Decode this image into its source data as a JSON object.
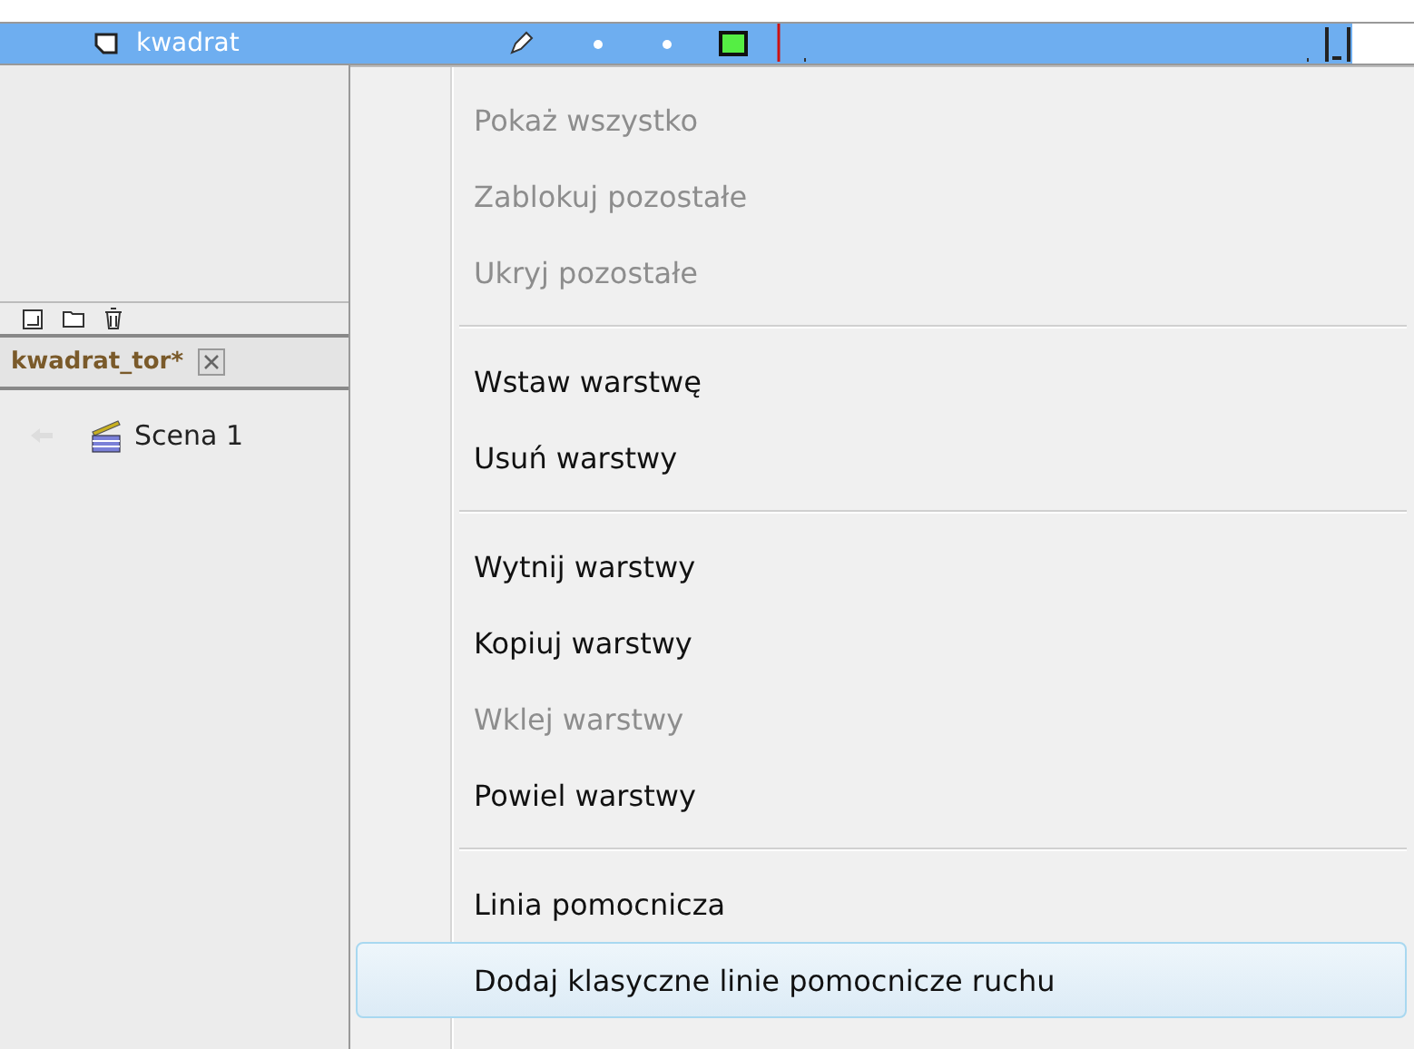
{
  "layer_row": {
    "name": "kwadrat",
    "selected": true
  },
  "document_tab": {
    "label": "kwadrat_tor*"
  },
  "breadcrumb": {
    "scene": "Scena 1"
  },
  "context_menu": {
    "items": [
      {
        "kind": "item",
        "label": "Pokaż wszystko",
        "disabled": true,
        "selected": false
      },
      {
        "kind": "item",
        "label": "Zablokuj pozostałe",
        "disabled": true,
        "selected": false
      },
      {
        "kind": "item",
        "label": "Ukryj pozostałe",
        "disabled": true,
        "selected": false
      },
      {
        "kind": "separator"
      },
      {
        "kind": "item",
        "label": "Wstaw warstwę",
        "disabled": false,
        "selected": false
      },
      {
        "kind": "item",
        "label": "Usuń warstwy",
        "disabled": false,
        "selected": false
      },
      {
        "kind": "separator"
      },
      {
        "kind": "item",
        "label": "Wytnij warstwy",
        "disabled": false,
        "selected": false
      },
      {
        "kind": "item",
        "label": "Kopiuj warstwy",
        "disabled": false,
        "selected": false
      },
      {
        "kind": "item",
        "label": "Wklej warstwy",
        "disabled": true,
        "selected": false
      },
      {
        "kind": "item",
        "label": "Powiel warstwy",
        "disabled": false,
        "selected": false
      },
      {
        "kind": "separator"
      },
      {
        "kind": "item",
        "label": "Linia pomocnicza",
        "disabled": false,
        "selected": false
      },
      {
        "kind": "item",
        "label": "Dodaj klasyczne linie pomocnicze ruchu",
        "disabled": false,
        "selected": true
      }
    ]
  }
}
